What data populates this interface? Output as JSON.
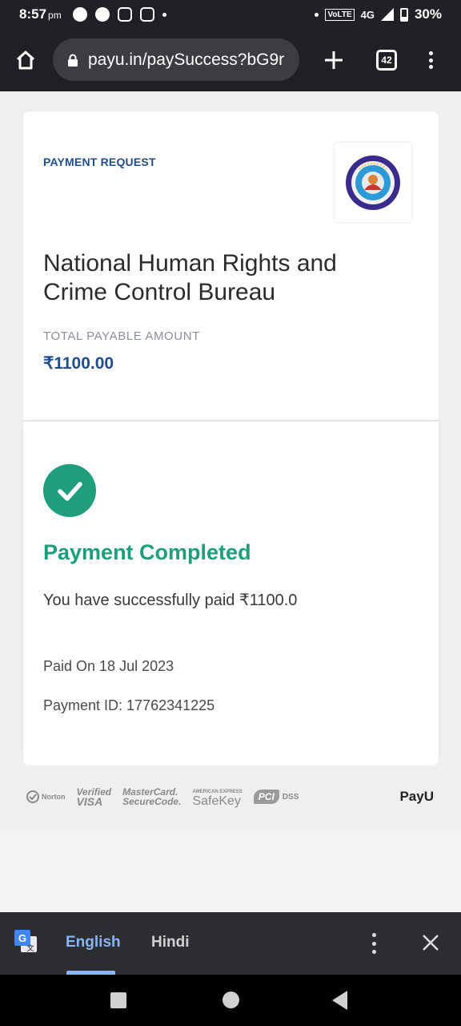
{
  "status_bar": {
    "time": "8:57",
    "ampm": "pm",
    "volte": "VoLTE",
    "network": "4G",
    "battery": "30%"
  },
  "browser": {
    "url": "payu.in/paySuccess?bG9r",
    "tab_count": "42"
  },
  "payment_request": {
    "label": "PAYMENT REQUEST",
    "merchant_name": "National Human Rights and Crime Control Bureau",
    "total_label": "TOTAL PAYABLE AMOUNT",
    "total_amount": "₹1100.00"
  },
  "confirmation": {
    "title": "Payment Completed",
    "message": "You have successfully paid ₹1100.0",
    "paid_on": "Paid On 18 Jul 2023",
    "payment_id": "Payment ID: 17762341225"
  },
  "trust_badges": {
    "norton": "Norton",
    "verified_visa_1": "Verified",
    "verified_visa_2": "VISA",
    "mastercard_1": "MasterCard.",
    "mastercard_2": "SecureCode.",
    "amex_small": "AMERICAN EXPRESS",
    "safekey": "SafeKey",
    "pci": "PCI",
    "dss": "DSS",
    "brand": "PayU"
  },
  "translate_bar": {
    "lang_1": "English",
    "lang_2": "Hindi"
  },
  "colors": {
    "accent_blue": "#1f4e8c",
    "success_green": "#1e9e7c",
    "translate_active": "#8ab4f8"
  },
  "icons": [
    "home-icon",
    "lock-icon",
    "plus-icon",
    "tabs-icon",
    "more-vert-icon",
    "check-icon",
    "google-translate-icon",
    "close-icon"
  ]
}
